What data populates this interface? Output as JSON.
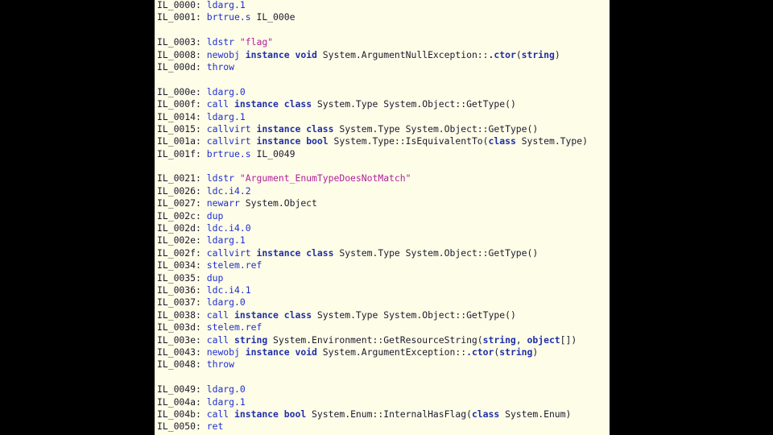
{
  "colors": {
    "background": "#000000",
    "editor_background": "#fefde8",
    "label": "#1a1a2e",
    "opcode": "#1e2fd0",
    "keyword": "#1f2fa8",
    "string": "#b0209a"
  },
  "lines": [
    [
      {
        "t": "IL_0000: ",
        "c": "label"
      },
      {
        "t": "ldarg.1",
        "c": "op"
      }
    ],
    [
      {
        "t": "IL_0001: ",
        "c": "label"
      },
      {
        "t": "brtrue.s",
        "c": "op"
      },
      {
        "t": " IL_000e",
        "c": "plain"
      }
    ],
    [],
    [
      {
        "t": "IL_0003: ",
        "c": "label"
      },
      {
        "t": "ldstr",
        "c": "op"
      },
      {
        "t": " ",
        "c": "plain"
      },
      {
        "t": "\"flag\"",
        "c": "str"
      }
    ],
    [
      {
        "t": "IL_0008: ",
        "c": "label"
      },
      {
        "t": "newobj",
        "c": "op"
      },
      {
        "t": " ",
        "c": "plain"
      },
      {
        "t": "instance",
        "c": "kw"
      },
      {
        "t": " ",
        "c": "plain"
      },
      {
        "t": "void",
        "c": "kw"
      },
      {
        "t": " System.ArgumentNullException::",
        "c": "plain"
      },
      {
        "t": ".ctor",
        "c": "kw"
      },
      {
        "t": "(",
        "c": "plain"
      },
      {
        "t": "string",
        "c": "kw"
      },
      {
        "t": ")",
        "c": "plain"
      }
    ],
    [
      {
        "t": "IL_000d: ",
        "c": "label"
      },
      {
        "t": "throw",
        "c": "op"
      }
    ],
    [],
    [
      {
        "t": "IL_000e: ",
        "c": "label"
      },
      {
        "t": "ldarg.0",
        "c": "op"
      }
    ],
    [
      {
        "t": "IL_000f: ",
        "c": "label"
      },
      {
        "t": "call",
        "c": "op"
      },
      {
        "t": " ",
        "c": "plain"
      },
      {
        "t": "instance",
        "c": "kw"
      },
      {
        "t": " ",
        "c": "plain"
      },
      {
        "t": "class",
        "c": "kw"
      },
      {
        "t": " System.Type System.Object::GetType()",
        "c": "plain"
      }
    ],
    [
      {
        "t": "IL_0014: ",
        "c": "label"
      },
      {
        "t": "ldarg.1",
        "c": "op"
      }
    ],
    [
      {
        "t": "IL_0015: ",
        "c": "label"
      },
      {
        "t": "callvirt",
        "c": "op"
      },
      {
        "t": " ",
        "c": "plain"
      },
      {
        "t": "instance",
        "c": "kw"
      },
      {
        "t": " ",
        "c": "plain"
      },
      {
        "t": "class",
        "c": "kw"
      },
      {
        "t": " System.Type System.Object::GetType()",
        "c": "plain"
      }
    ],
    [
      {
        "t": "IL_001a: ",
        "c": "label"
      },
      {
        "t": "callvirt",
        "c": "op"
      },
      {
        "t": " ",
        "c": "plain"
      },
      {
        "t": "instance",
        "c": "kw"
      },
      {
        "t": " ",
        "c": "plain"
      },
      {
        "t": "bool",
        "c": "kw"
      },
      {
        "t": " System.Type::IsEquivalentTo(",
        "c": "plain"
      },
      {
        "t": "class",
        "c": "kw"
      },
      {
        "t": " System.Type)",
        "c": "plain"
      }
    ],
    [
      {
        "t": "IL_001f: ",
        "c": "label"
      },
      {
        "t": "brtrue.s",
        "c": "op"
      },
      {
        "t": " IL_0049",
        "c": "plain"
      }
    ],
    [],
    [
      {
        "t": "IL_0021: ",
        "c": "label"
      },
      {
        "t": "ldstr",
        "c": "op"
      },
      {
        "t": " ",
        "c": "plain"
      },
      {
        "t": "\"Argument_EnumTypeDoesNotMatch\"",
        "c": "str"
      }
    ],
    [
      {
        "t": "IL_0026: ",
        "c": "label"
      },
      {
        "t": "ldc.i4.2",
        "c": "op"
      }
    ],
    [
      {
        "t": "IL_0027: ",
        "c": "label"
      },
      {
        "t": "newarr",
        "c": "op"
      },
      {
        "t": " System.Object",
        "c": "plain"
      }
    ],
    [
      {
        "t": "IL_002c: ",
        "c": "label"
      },
      {
        "t": "dup",
        "c": "op"
      }
    ],
    [
      {
        "t": "IL_002d: ",
        "c": "label"
      },
      {
        "t": "ldc.i4.0",
        "c": "op"
      }
    ],
    [
      {
        "t": "IL_002e: ",
        "c": "label"
      },
      {
        "t": "ldarg.1",
        "c": "op"
      }
    ],
    [
      {
        "t": "IL_002f: ",
        "c": "label"
      },
      {
        "t": "callvirt",
        "c": "op"
      },
      {
        "t": " ",
        "c": "plain"
      },
      {
        "t": "instance",
        "c": "kw"
      },
      {
        "t": " ",
        "c": "plain"
      },
      {
        "t": "class",
        "c": "kw"
      },
      {
        "t": " System.Type System.Object::GetType()",
        "c": "plain"
      }
    ],
    [
      {
        "t": "IL_0034: ",
        "c": "label"
      },
      {
        "t": "stelem.ref",
        "c": "op"
      }
    ],
    [
      {
        "t": "IL_0035: ",
        "c": "label"
      },
      {
        "t": "dup",
        "c": "op"
      }
    ],
    [
      {
        "t": "IL_0036: ",
        "c": "label"
      },
      {
        "t": "ldc.i4.1",
        "c": "op"
      }
    ],
    [
      {
        "t": "IL_0037: ",
        "c": "label"
      },
      {
        "t": "ldarg.0",
        "c": "op"
      }
    ],
    [
      {
        "t": "IL_0038: ",
        "c": "label"
      },
      {
        "t": "call",
        "c": "op"
      },
      {
        "t": " ",
        "c": "plain"
      },
      {
        "t": "instance",
        "c": "kw"
      },
      {
        "t": " ",
        "c": "plain"
      },
      {
        "t": "class",
        "c": "kw"
      },
      {
        "t": " System.Type System.Object::GetType()",
        "c": "plain"
      }
    ],
    [
      {
        "t": "IL_003d: ",
        "c": "label"
      },
      {
        "t": "stelem.ref",
        "c": "op"
      }
    ],
    [
      {
        "t": "IL_003e: ",
        "c": "label"
      },
      {
        "t": "call",
        "c": "op"
      },
      {
        "t": " ",
        "c": "plain"
      },
      {
        "t": "string",
        "c": "kw"
      },
      {
        "t": " System.Environment::GetResourceString(",
        "c": "plain"
      },
      {
        "t": "string",
        "c": "kw"
      },
      {
        "t": ", ",
        "c": "plain"
      },
      {
        "t": "object",
        "c": "kw"
      },
      {
        "t": "[])",
        "c": "plain"
      }
    ],
    [
      {
        "t": "IL_0043: ",
        "c": "label"
      },
      {
        "t": "newobj",
        "c": "op"
      },
      {
        "t": " ",
        "c": "plain"
      },
      {
        "t": "instance",
        "c": "kw"
      },
      {
        "t": " ",
        "c": "plain"
      },
      {
        "t": "void",
        "c": "kw"
      },
      {
        "t": " System.ArgumentException::",
        "c": "plain"
      },
      {
        "t": ".ctor",
        "c": "kw"
      },
      {
        "t": "(",
        "c": "plain"
      },
      {
        "t": "string",
        "c": "kw"
      },
      {
        "t": ")",
        "c": "plain"
      }
    ],
    [
      {
        "t": "IL_0048: ",
        "c": "label"
      },
      {
        "t": "throw",
        "c": "op"
      }
    ],
    [],
    [
      {
        "t": "IL_0049: ",
        "c": "label"
      },
      {
        "t": "ldarg.0",
        "c": "op"
      }
    ],
    [
      {
        "t": "IL_004a: ",
        "c": "label"
      },
      {
        "t": "ldarg.1",
        "c": "op"
      }
    ],
    [
      {
        "t": "IL_004b: ",
        "c": "label"
      },
      {
        "t": "call",
        "c": "op"
      },
      {
        "t": " ",
        "c": "plain"
      },
      {
        "t": "instance",
        "c": "kw"
      },
      {
        "t": " ",
        "c": "plain"
      },
      {
        "t": "bool",
        "c": "kw"
      },
      {
        "t": " System.Enum::InternalHasFlag(",
        "c": "plain"
      },
      {
        "t": "class",
        "c": "kw"
      },
      {
        "t": " System.Enum)",
        "c": "plain"
      }
    ],
    [
      {
        "t": "IL_0050: ",
        "c": "label"
      },
      {
        "t": "ret",
        "c": "op"
      }
    ]
  ]
}
